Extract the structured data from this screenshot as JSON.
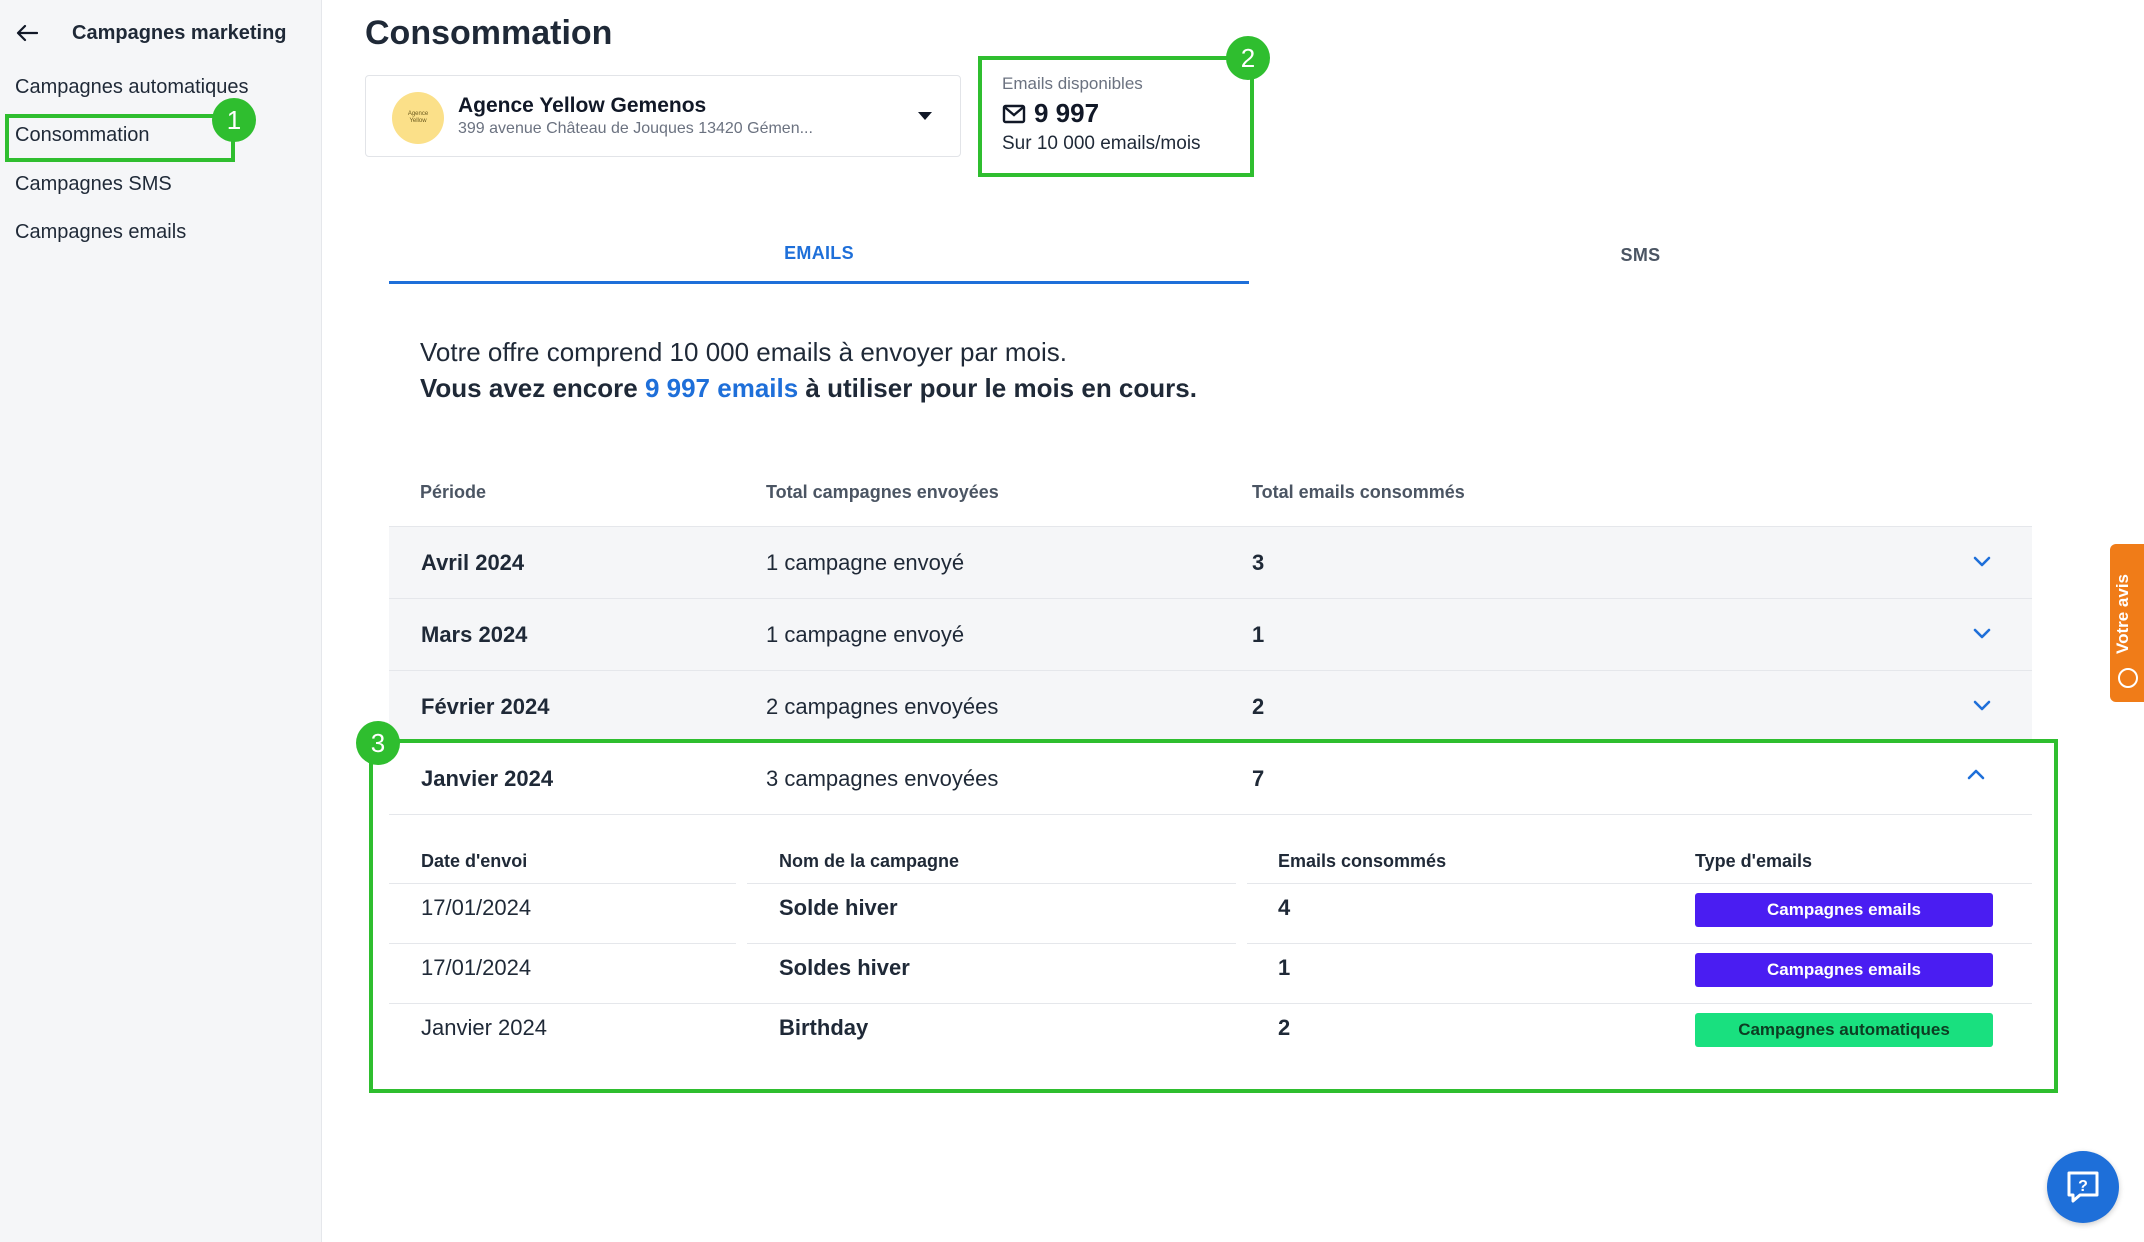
{
  "sidebar": {
    "title": "Campagnes marketing",
    "items": [
      {
        "label": "Campagnes automatiques"
      },
      {
        "label": "Consommation"
      },
      {
        "label": "Campagnes SMS"
      },
      {
        "label": "Campagnes emails"
      }
    ]
  },
  "page": {
    "title": "Consommation"
  },
  "agency": {
    "logo_text_1": "Agence",
    "logo_text_2": "Yellow",
    "name": "Agence Yellow Gemenos",
    "address": "399 avenue Château de Jouques 13420 Gémen..."
  },
  "availability": {
    "label": "Emails disponibles",
    "value": "9 997",
    "sub": "Sur 10 000 emails/mois"
  },
  "tabs": [
    {
      "label": "EMAILS",
      "active": true
    },
    {
      "label": "SMS",
      "active": false
    }
  ],
  "offer": {
    "line1": "Votre offre comprend 10 000 emails à envoyer par mois.",
    "line2_prefix": "Vous avez encore ",
    "line2_highlight": "9 997 emails",
    "line2_suffix": " à utiliser pour le mois en cours."
  },
  "table": {
    "headers": [
      "Période",
      "Total campagnes envoyées",
      "Total emails consommés"
    ],
    "rows": [
      {
        "period": "Avril 2024",
        "campaigns": "1 campagne envoyé",
        "emails": "3"
      },
      {
        "period": "Mars 2024",
        "campaigns": "1 campagne envoyé",
        "emails": "1"
      },
      {
        "period": "Février 2024",
        "campaigns": "2 campagnes envoyées",
        "emails": "2"
      }
    ],
    "expanded": {
      "period": "Janvier 2024",
      "campaigns": "3 campagnes envoyées",
      "emails": "7",
      "sub_headers": [
        "Date d'envoi",
        "Nom de la campagne",
        "Emails consommés",
        "Type d'emails"
      ],
      "sub_rows": [
        {
          "date": "17/01/2024",
          "name": "Solde hiver",
          "emails": "4",
          "type": "Campagnes emails"
        },
        {
          "date": "17/01/2024",
          "name": "Soldes hiver",
          "emails": "1",
          "type": "Campagnes emails"
        },
        {
          "date": "Janvier 2024",
          "name": "Birthday",
          "emails": "2",
          "type": "Campagnes automatiques"
        }
      ]
    }
  },
  "annotations": [
    "1",
    "2",
    "3"
  ],
  "feedback": {
    "label": "Votre avis"
  },
  "icons": {
    "back": "arrow-left-icon",
    "mail": "mail-icon",
    "caret": "caret-down-icon",
    "chevron_down": "chevron-down-icon",
    "chevron_up": "chevron-up-icon",
    "help": "help-chat-icon",
    "feedback": "feedback-icon"
  },
  "colors": {
    "accent": "#1e6fd9",
    "annotation": "#2fbe2f",
    "badge_emails": "#4a1df2",
    "badge_auto": "#19e07f",
    "feedback": "#f07c18"
  }
}
